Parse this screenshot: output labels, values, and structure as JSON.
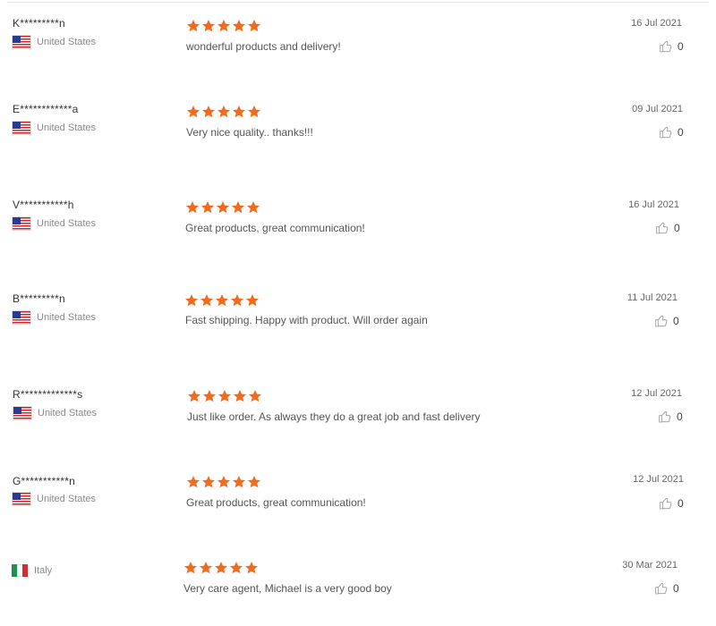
{
  "colors": {
    "star": "#f26a1b",
    "text": "#555555",
    "muted": "#8a8a8a"
  },
  "icons": {
    "star": "star-icon",
    "like": "thumbs-up-icon",
    "us_flag": "us-flag-icon",
    "it_flag": "italy-flag-icon"
  },
  "reviews": [
    {
      "user": "K*********n",
      "country": "United States",
      "flag": "us",
      "rating": 5,
      "text": "wonderful products and delivery!",
      "date": "16 Jul 2021",
      "likes": "0"
    },
    {
      "user": "E************a",
      "country": "United States",
      "flag": "us",
      "rating": 5,
      "text": "Very nice quality.. thanks!!!",
      "date": "09 Jul 2021",
      "likes": "0"
    },
    {
      "user": "V***********h",
      "country": "United States",
      "flag": "us",
      "rating": 5,
      "text": "Great products, great communication!",
      "date": "16 Jul 2021",
      "likes": "0"
    },
    {
      "user": "B*********n",
      "country": "United States",
      "flag": "us",
      "rating": 5,
      "text": "Fast shipping. Happy with product. Will order again",
      "date": "11 Jul 2021",
      "likes": "0"
    },
    {
      "user": "R*************s",
      "country": "United States",
      "flag": "us",
      "rating": 5,
      "text": "Just like order. As always they do a great job and fast delivery",
      "date": "12 Jul 2021",
      "likes": "0"
    },
    {
      "user": "G***********n",
      "country": "United States",
      "flag": "us",
      "rating": 5,
      "text": "Great products, great communication!",
      "date": "12 Jul 2021",
      "likes": "0"
    },
    {
      "user": "",
      "country": "Italy",
      "flag": "it",
      "rating": 5,
      "text": "Very care agent, Michael is a very good boy",
      "date": "30 Mar 2021",
      "likes": "0"
    }
  ]
}
